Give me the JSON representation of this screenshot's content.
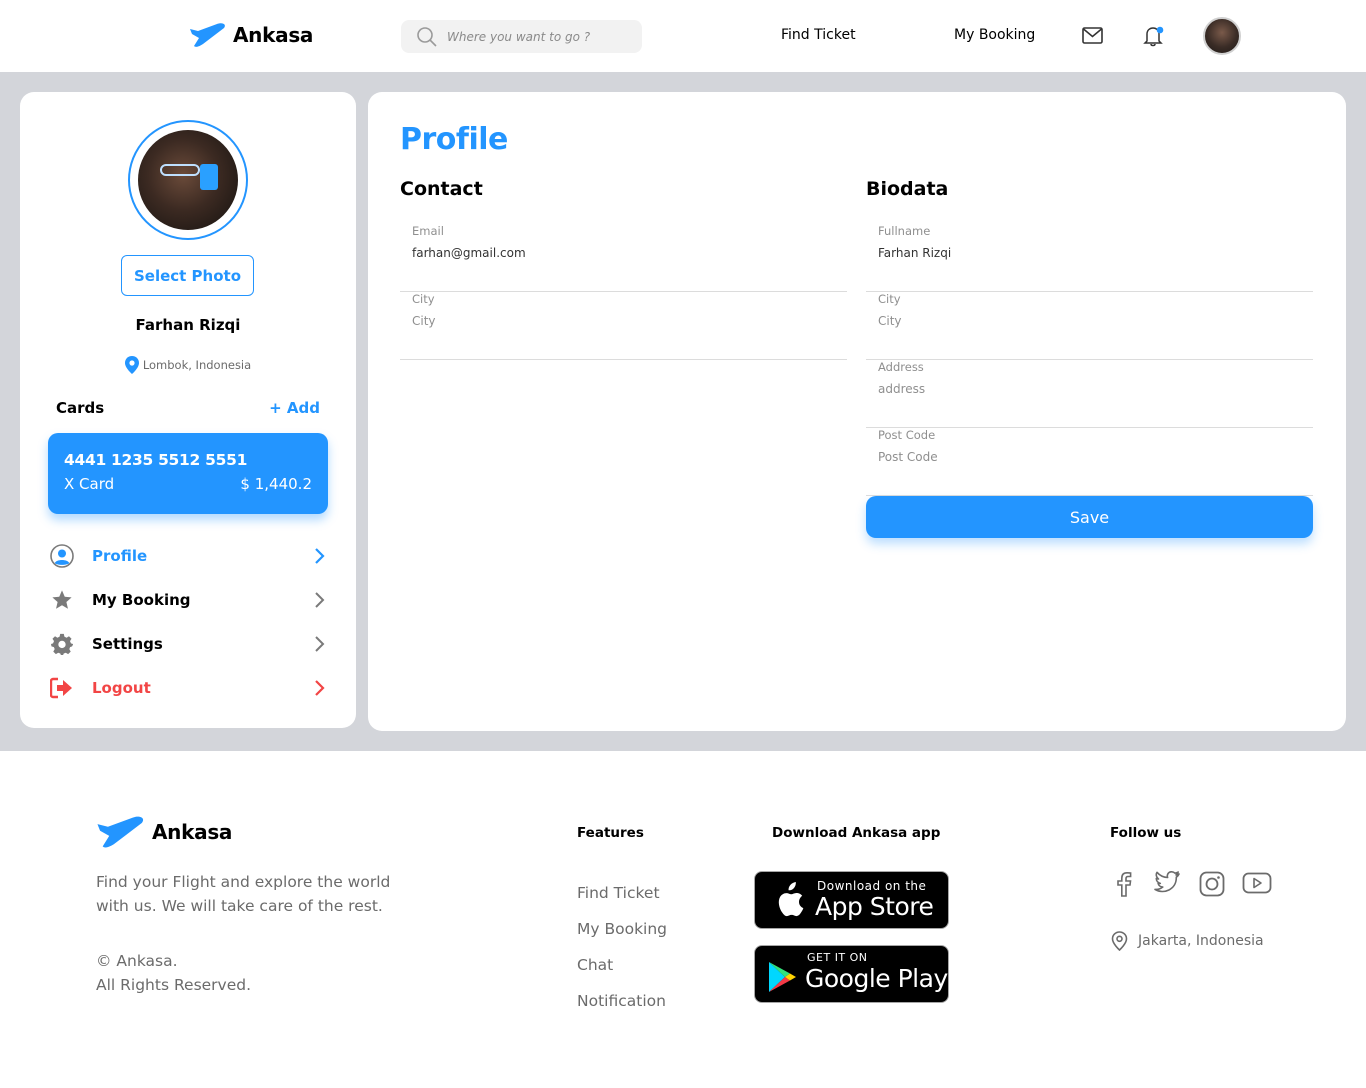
{
  "brand": {
    "name": "Ankasa",
    "accent": "#2395ff",
    "logout_color": "#f24545"
  },
  "header": {
    "search_placeholder": "Where you want to go ?",
    "nav": {
      "find_ticket": "Find Ticket",
      "my_booking": "My Booking"
    },
    "icons": [
      "mail-icon",
      "bell-icon"
    ]
  },
  "sidebar": {
    "select_photo": "Select Photo",
    "name": "Farhan Rizqi",
    "location": "Lombok, Indonesia",
    "cards_label": "Cards",
    "add_label": "+ Add",
    "card": {
      "number": "4441 1235 5512 5551",
      "type": "X Card",
      "balance": "$ 1,440.2"
    },
    "menu": [
      {
        "label": "Profile",
        "icon": "user-icon",
        "active": true
      },
      {
        "label": "My Booking",
        "icon": "star-icon"
      },
      {
        "label": "Settings",
        "icon": "gear-icon"
      },
      {
        "label": "Logout",
        "icon": "logout-icon"
      }
    ]
  },
  "profile": {
    "title": "Profile",
    "contact": {
      "heading": "Contact",
      "email": {
        "label": "Email",
        "value": "farhan@gmail.com"
      },
      "city": {
        "label": "City",
        "placeholder": "City"
      }
    },
    "biodata": {
      "heading": "Biodata",
      "fullname": {
        "label": "Fullname",
        "value": "Farhan Rizqi"
      },
      "city": {
        "label": "City",
        "placeholder": "City"
      },
      "address": {
        "label": "Address",
        "placeholder": "address"
      },
      "postcode": {
        "label": "Post Code",
        "placeholder": "Post Code"
      }
    },
    "save": "Save"
  },
  "footer": {
    "description": "Find your Flight and explore the world with us. We will take care of the rest.",
    "copyright_1": "© Ankasa.",
    "copyright_2": "All Rights Reserved.",
    "features_heading": "Features",
    "features": [
      "Find Ticket",
      "My Booking",
      "Chat",
      "Notification"
    ],
    "download_heading": "Download Ankasa app",
    "app_store": {
      "small": "Download on the",
      "big": "App Store"
    },
    "google_play": {
      "small": "GET IT ON",
      "big": "Google Play"
    },
    "follow_heading": "Follow us",
    "social": [
      "facebook-icon",
      "twitter-icon",
      "instagram-icon",
      "youtube-icon"
    ],
    "location": "Jakarta, Indonesia"
  }
}
